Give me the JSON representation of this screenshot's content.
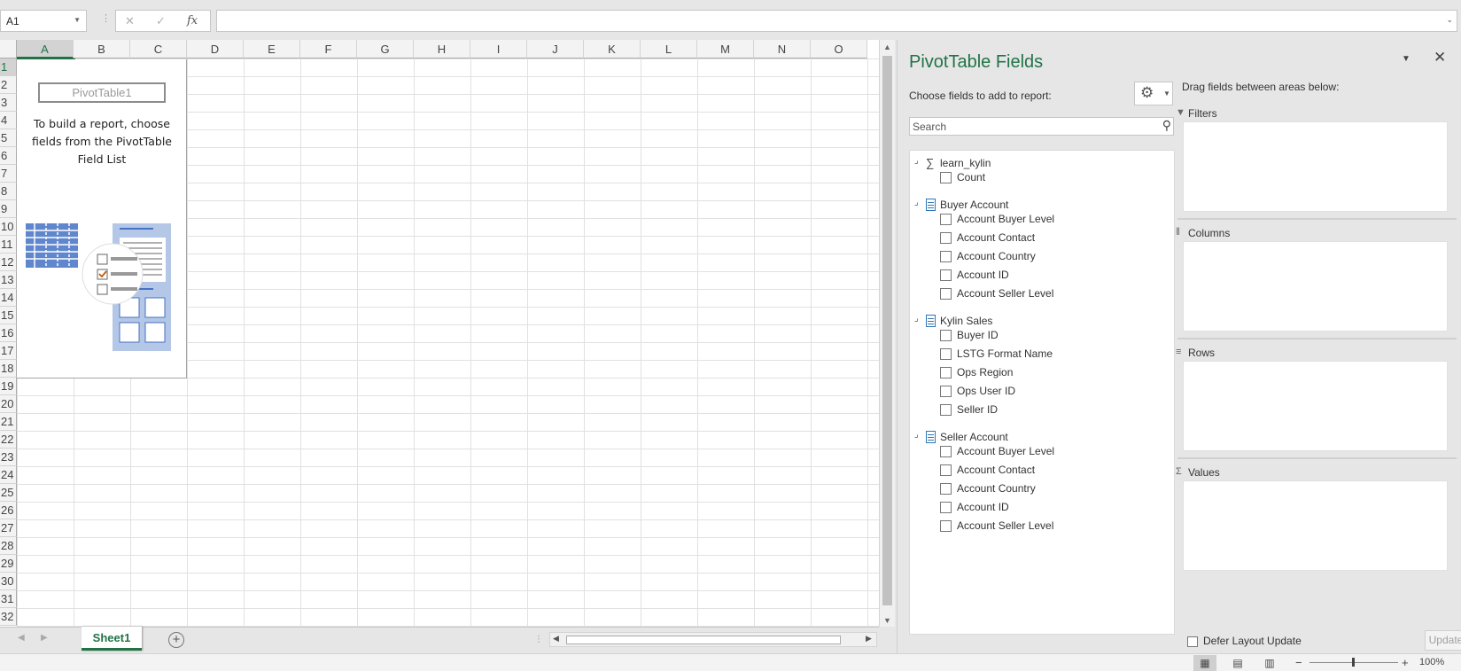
{
  "formula_bar": {
    "name_box": "A1",
    "cancel_icon": "✕",
    "enter_icon": "✓",
    "fx_label": "fx",
    "formula_value": ""
  },
  "grid": {
    "columns": [
      "A",
      "B",
      "C",
      "D",
      "E",
      "F",
      "G",
      "H",
      "I",
      "J",
      "K",
      "L",
      "M",
      "N",
      "O"
    ],
    "rows": [
      "1",
      "2",
      "3",
      "4",
      "5",
      "6",
      "7",
      "8",
      "9",
      "10",
      "11",
      "12",
      "13",
      "14",
      "15",
      "16",
      "17",
      "18",
      "19",
      "20",
      "21",
      "22",
      "23",
      "24",
      "25",
      "26",
      "27",
      "28",
      "29",
      "30",
      "31",
      "32"
    ],
    "active_cell": "A1"
  },
  "pivot_placeholder": {
    "name": "PivotTable1",
    "instructions": "To build a report, choose fields from the PivotTable Field List"
  },
  "sheet_tabs": [
    {
      "label": "Sheet1",
      "active": true
    }
  ],
  "status_bar": {
    "zoom_minus": "−",
    "zoom_plus": "+",
    "zoom_level": "100%"
  },
  "pivot_pane": {
    "title": "PivotTable Fields",
    "choose_label": "Choose fields to add to report:",
    "search_placeholder": "Search",
    "drag_label": "Drag fields between areas below:",
    "groups": [
      {
        "name": "learn_kylin",
        "icon": "sigma-icon",
        "fields": [
          "Count"
        ]
      },
      {
        "name": "Buyer Account",
        "icon": "table-icon",
        "fields": [
          "Account Buyer Level",
          "Account Contact",
          "Account Country",
          "Account ID",
          "Account Seller Level"
        ]
      },
      {
        "name": "Kylin Sales",
        "icon": "table-icon",
        "fields": [
          "Buyer ID",
          "LSTG Format Name",
          "Ops Region",
          "Ops User ID",
          "Seller ID"
        ]
      },
      {
        "name": "Seller Account",
        "icon": "table-icon",
        "fields": [
          "Account Buyer Level",
          "Account Contact",
          "Account Country",
          "Account ID",
          "Account Seller Level"
        ]
      }
    ],
    "areas": [
      {
        "label": "Filters",
        "icon": "filter-icon",
        "glyph": "▼"
      },
      {
        "label": "Columns",
        "icon": "columns-icon",
        "glyph": "⦀"
      },
      {
        "label": "Rows",
        "icon": "rows-icon",
        "glyph": "≡"
      },
      {
        "label": "Values",
        "icon": "sigma-icon",
        "glyph": "Σ"
      }
    ],
    "defer_label": "Defer Layout Update",
    "update_label": "Update"
  },
  "colors": {
    "accent": "#217346",
    "table_icon": "#2e75b6"
  }
}
